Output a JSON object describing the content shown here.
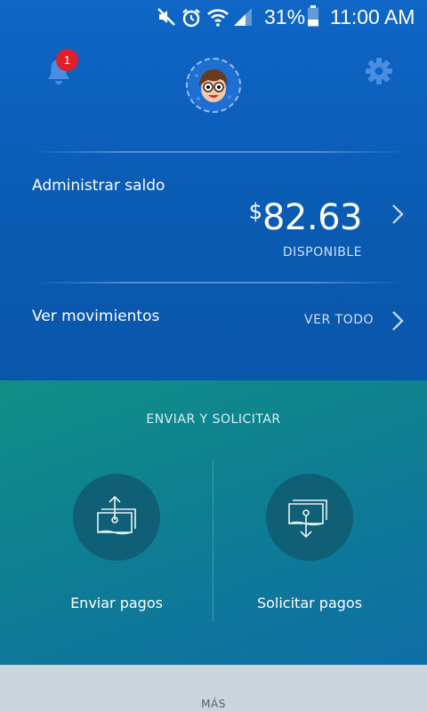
{
  "status_bar": {
    "battery_percent": "31%",
    "time": "11:00 AM",
    "icons": [
      "mute-icon",
      "alarm-icon",
      "wifi-icon",
      "signal-icon",
      "battery-icon"
    ]
  },
  "header": {
    "notification_count": "1",
    "bell_icon": "bell-icon",
    "settings_icon": "gear-icon",
    "avatar": "cartoon-avatar"
  },
  "balance": {
    "label": "Administrar saldo",
    "currency_symbol": "$",
    "amount": "82.63",
    "status": "DISPONIBLE"
  },
  "activity": {
    "label": "Ver movimientos",
    "link": "VER TODO"
  },
  "send_request": {
    "title": "ENVIAR Y SOLICITAR",
    "send_label": "Enviar pagos",
    "request_label": "Solicitar pagos"
  },
  "more": {
    "label": "MÁS"
  },
  "colors": {
    "blue_bg": "#0a5bb0",
    "teal_bg": "#0e7f92",
    "badge_red": "#e01e2c",
    "gray_bg": "#cbd5dc"
  }
}
